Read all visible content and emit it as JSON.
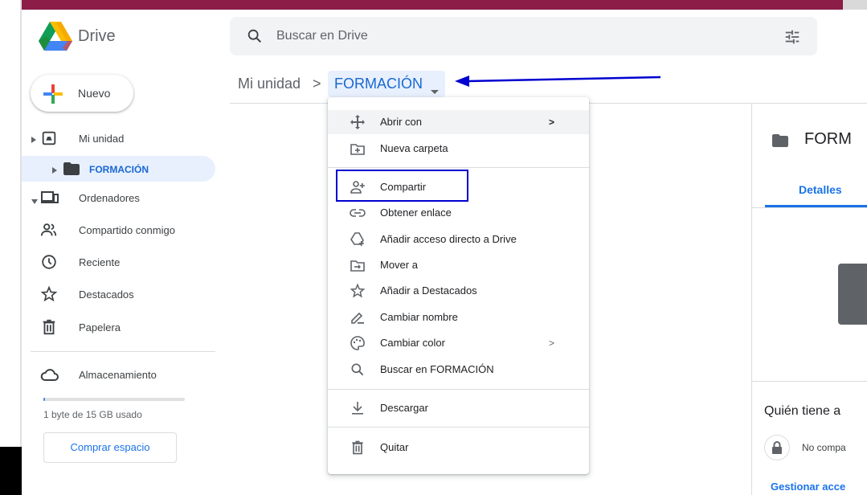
{
  "app": {
    "name": "Drive"
  },
  "search": {
    "placeholder": "Buscar en Drive"
  },
  "sidebar": {
    "new_label": "Nuevo",
    "items": [
      {
        "label": "Mi unidad",
        "icon": "my-drive-icon"
      },
      {
        "label": "FORMACIÓN",
        "icon": "folder-icon",
        "active": true
      },
      {
        "label": "Ordenadores",
        "icon": "computers-icon"
      },
      {
        "label": "Compartido conmigo",
        "icon": "shared-icon"
      },
      {
        "label": "Reciente",
        "icon": "clock-icon"
      },
      {
        "label": "Destacados",
        "icon": "star-icon"
      },
      {
        "label": "Papelera",
        "icon": "trash-icon"
      }
    ],
    "storage": {
      "label": "Almacenamiento",
      "usage": "1 byte de 15 GB usado",
      "buy_label": "Comprar espacio"
    }
  },
  "breadcrumb": {
    "root": "Mi unidad",
    "separator": ">",
    "current": "FORMACIÓN"
  },
  "context_menu": {
    "items": [
      {
        "label": "Abrir con",
        "icon": "open-with-icon",
        "submenu": true
      },
      {
        "label": "Nueva carpeta",
        "icon": "new-folder-icon"
      },
      {
        "label": "Compartir",
        "icon": "share-icon"
      },
      {
        "label": "Obtener enlace",
        "icon": "link-icon"
      },
      {
        "label": "Añadir acceso directo a Drive",
        "icon": "add-shortcut-icon"
      },
      {
        "label": "Mover a",
        "icon": "move-icon"
      },
      {
        "label": "Añadir a Destacados",
        "icon": "star-icon"
      },
      {
        "label": "Cambiar nombre",
        "icon": "rename-icon"
      },
      {
        "label": "Cambiar color",
        "icon": "palette-icon",
        "submenu": true
      },
      {
        "label": "Buscar en FORMACIÓN",
        "icon": "search-icon"
      },
      {
        "label": "Descargar",
        "icon": "download-icon"
      },
      {
        "label": "Quitar",
        "icon": "trash-icon"
      }
    ],
    "submenu_arrow": ">"
  },
  "details_panel": {
    "title": "FORM",
    "tab": "Detalles",
    "access_heading": "Quién tiene a",
    "access_status": "No compa",
    "manage_label": "Gestionar acce"
  },
  "colors": {
    "accent": "#1a73e8",
    "annotation": "#0000d0",
    "active_bg": "#e8f0fe"
  }
}
